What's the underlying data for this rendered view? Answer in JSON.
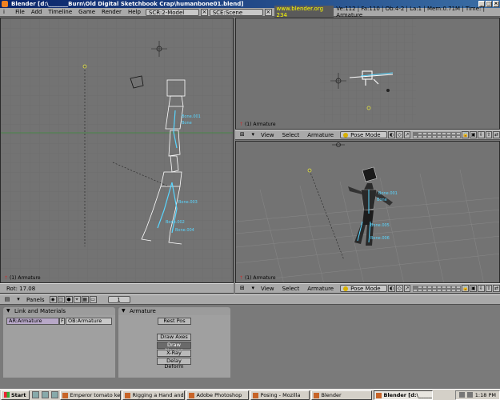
{
  "window": {
    "title": "Blender [d:\\_______Burn\\Old Digital Sketchbook Crap\\humanbone01.blend]"
  },
  "infobar": {
    "menus": [
      "File",
      "Add",
      "Timeline",
      "Game",
      "Render",
      "Help"
    ],
    "screen": "SCR:2-Model",
    "scene": "SCE:Scene",
    "url": "www.blender.org 234",
    "stats": "Ve:112 | Fa:110 | Ob:4-2 | La:1 | Mem:0.71M | Time: | Armature"
  },
  "viewports": {
    "left_label": "(1) Armature",
    "left_status": "Rot: 17.08",
    "tr_label": "(1) Armature",
    "br_label": "(1) Armature"
  },
  "viewheader": {
    "view": "View",
    "select": "Select",
    "armature": "Armature",
    "mode": "Pose Mode"
  },
  "buttons_window": {
    "panels_label": "Panels",
    "frame": "1",
    "link_panel": {
      "title": "Link and Materials",
      "ar_field": "AR:Armature",
      "f_flag": "F",
      "ob_field": "OB:Armature"
    },
    "armature_panel": {
      "title": "Armature",
      "rest_pos": "Rest Pos",
      "draw_axes": "Draw Axes",
      "draw_names": "Draw Names",
      "xray": "X-Ray",
      "delay_deform": "Delay Deform"
    }
  },
  "taskbar": {
    "start": "Start",
    "tasks": [
      "Emperor tomato ketchup",
      "Rigging a Hand and a Foo...",
      "Adobe Photoshop",
      "Posing - Mozilla",
      "Blender",
      "Blender [d:\\_______Bu..."
    ],
    "clock": "1:18 PM"
  },
  "bones": [
    "Bone.001",
    "Bone",
    "Bone.003",
    "Bone.002",
    "Bone.004",
    "Bone.005",
    "Bone.006"
  ],
  "colors": {
    "title_bar": "#0a246a",
    "header": "#a9a9a9",
    "viewport_bg": "#737373",
    "bone_label": "#5ad6ff",
    "grid_line": "#6a6a6a",
    "axis_x": "#c83232",
    "axis_y": "#32a032"
  }
}
